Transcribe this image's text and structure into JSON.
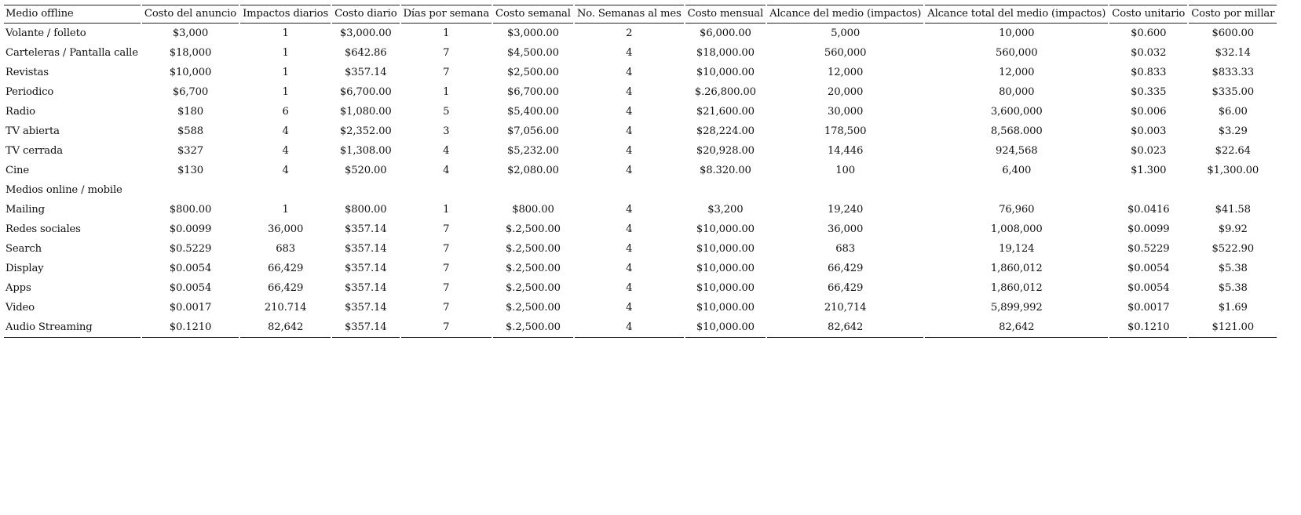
{
  "table": {
    "headers": [
      "Medio offline",
      "Costo del anuncio",
      "Impactos diarios",
      "Costo diario",
      "Días por semana",
      "Costo semanal",
      "No. Semanas al mes",
      "Costo mensual",
      "Alcance del medio (impactos)",
      "Alcance total del medio (impactos)",
      "Costo unitario",
      "Costo por millar"
    ],
    "rows": [
      {
        "type": "data",
        "cells": [
          "Volante / folleto",
          "$3,000",
          "1",
          "$3,000.00",
          "1",
          "$3,000.00",
          "2",
          "$6,000.00",
          "5,000",
          "10,000",
          "$0.600",
          "$600.00"
        ]
      },
      {
        "type": "data",
        "cells": [
          "Carteleras / Pantalla calle",
          "$18,000",
          "1",
          "$642.86",
          "7",
          "$4,500.00",
          "4",
          "$18,000.00",
          "560,000",
          "560,000",
          "$0.032",
          "$32.14"
        ]
      },
      {
        "type": "data",
        "cells": [
          "Revistas",
          "$10,000",
          "1",
          "$357.14",
          "7",
          "$2,500.00",
          "4",
          "$10,000.00",
          "12,000",
          "12,000",
          "$0.833",
          "$833.33"
        ]
      },
      {
        "type": "data",
        "cells": [
          "Periodico",
          "$6,700",
          "1",
          "$6,700.00",
          "1",
          "$6,700.00",
          "4",
          "$.26,800.00",
          "20,000",
          "80,000",
          "$0.335",
          "$335.00"
        ]
      },
      {
        "type": "data",
        "cells": [
          "Radio",
          "$180",
          "6",
          "$1,080.00",
          "5",
          "$5,400.00",
          "4",
          "$21,600.00",
          "30,000",
          "3,600,000",
          "$0.006",
          "$6.00"
        ]
      },
      {
        "type": "data",
        "cells": [
          "TV abierta",
          "$588",
          "4",
          "$2,352.00",
          "3",
          "$7,056.00",
          "4",
          "$28,224.00",
          "178,500",
          "8,568.000",
          "$0.003",
          "$3.29"
        ]
      },
      {
        "type": "data",
        "cells": [
          "TV cerrada",
          "$327",
          "4",
          "$1,308.00",
          "4",
          "$5,232.00",
          "4",
          "$20,928.00",
          "14,446",
          "924,568",
          "$0.023",
          "$22.64"
        ]
      },
      {
        "type": "data",
        "cells": [
          "Cine",
          "$130",
          "4",
          "$520.00",
          "4",
          "$2,080.00",
          "4",
          "$8.320.00",
          "100",
          "6,400",
          "$1.300",
          "$1,300.00"
        ]
      },
      {
        "type": "section",
        "label": "Medios online / mobile"
      },
      {
        "type": "data",
        "cells": [
          "Mailing",
          "$800.00",
          "1",
          "$800.00",
          "1",
          "$800.00",
          "4",
          "$3,200",
          "19,240",
          "76,960",
          "$0.0416",
          "$41.58"
        ]
      },
      {
        "type": "data",
        "cells": [
          "Redes sociales",
          "$0.0099",
          "36,000",
          "$357.14",
          "7",
          "$.2,500.00",
          "4",
          "$10,000.00",
          "36,000",
          "1,008,000",
          "$0.0099",
          "$9.92"
        ]
      },
      {
        "type": "data",
        "cells": [
          "Search",
          "$0.5229",
          "683",
          "$357.14",
          "7",
          "$.2,500.00",
          "4",
          "$10,000.00",
          "683",
          "19,124",
          "$0.5229",
          "$522.90"
        ]
      },
      {
        "type": "data",
        "cells": [
          "Display",
          "$0.0054",
          "66,429",
          "$357.14",
          "7",
          "$.2,500.00",
          "4",
          "$10,000.00",
          "66,429",
          "1,860,012",
          "$0.0054",
          "$5.38"
        ]
      },
      {
        "type": "data",
        "cells": [
          "Apps",
          "$0.0054",
          "66,429",
          "$357.14",
          "7",
          "$.2,500.00",
          "4",
          "$10,000.00",
          "66,429",
          "1,860,012",
          "$0.0054",
          "$5.38"
        ]
      },
      {
        "type": "data",
        "cells": [
          "Video",
          "$0.0017",
          "210.714",
          "$357.14",
          "7",
          "$.2,500.00",
          "4",
          "$10,000.00",
          "210,714",
          "5,899,992",
          "$0.0017",
          "$1.69"
        ]
      },
      {
        "type": "data",
        "cells": [
          "Audio Streaming",
          "$0.1210",
          "82,642",
          "$357.14",
          "7",
          "$.2,500.00",
          "4",
          "$10,000.00",
          "82,642",
          "82,642",
          "$0.1210",
          "$121.00"
        ]
      }
    ]
  }
}
